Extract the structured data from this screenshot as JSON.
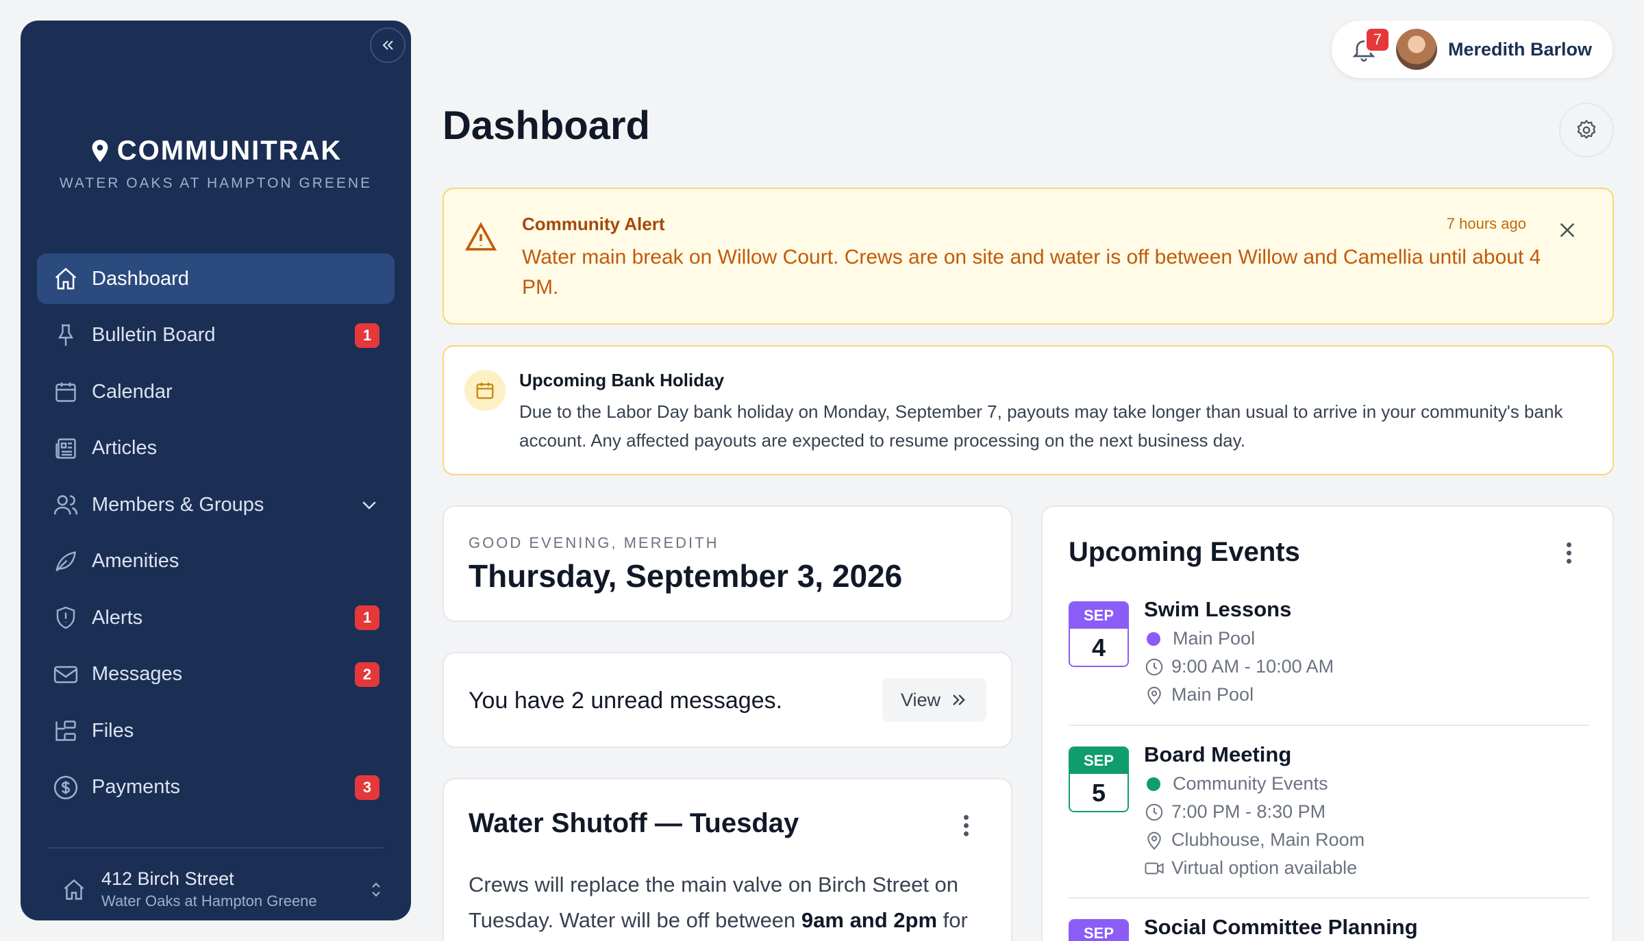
{
  "sidebar": {
    "brand": "COMMUNITRAK",
    "community": "WATER OAKS AT HAMPTON GREENE",
    "items": [
      {
        "label": "Dashboard",
        "icon": "home-icon",
        "badge": ""
      },
      {
        "label": "Bulletin Board",
        "icon": "pin-icon",
        "badge": "1"
      },
      {
        "label": "Calendar",
        "icon": "calendar-icon",
        "badge": ""
      },
      {
        "label": "Articles",
        "icon": "newspaper-icon",
        "badge": ""
      },
      {
        "label": "Members & Groups",
        "icon": "users-icon",
        "badge": ""
      },
      {
        "label": "Amenities",
        "icon": "leaf-icon",
        "badge": ""
      },
      {
        "label": "Alerts",
        "icon": "shield-alert-icon",
        "badge": "1"
      },
      {
        "label": "Messages",
        "icon": "mail-icon",
        "badge": "2"
      },
      {
        "label": "Files",
        "icon": "folder-tree-icon",
        "badge": ""
      },
      {
        "label": "Payments",
        "icon": "dollar-circle-icon",
        "badge": "3"
      }
    ],
    "address": {
      "line1": "412 Birch Street",
      "line2": "Water Oaks at Hampton Greene"
    }
  },
  "header": {
    "notification_count": "7",
    "user_name": "Meredith Barlow",
    "page_title": "Dashboard"
  },
  "alert": {
    "title": "Community Alert",
    "time": "7 hours ago",
    "body": "Water main break on Willow Court. Crews are on site and water is off between Willow and Camellia until about 4 PM."
  },
  "notice": {
    "title": "Upcoming Bank Holiday",
    "body": "Due to the Labor Day bank holiday on Monday, September 7, payouts may take longer than usual to arrive in your community's bank account. Any affected payouts are expected to resume processing on the next business day."
  },
  "greeting": {
    "label": "GOOD EVENING, MEREDITH",
    "date": "Thursday, September 3, 2026"
  },
  "messages": {
    "text": "You have 2 unread messages.",
    "view_label": "View"
  },
  "post": {
    "title": "Water Shutoff — Tuesday",
    "body_before": "Crews will replace the main valve on Birch Street on Tuesday. Water will be off between ",
    "body_bold": "9am and 2pm",
    "body_after": " for"
  },
  "events": {
    "title": "Upcoming Events",
    "items": [
      {
        "month": "SEP",
        "day": "4",
        "title": "Swim Lessons",
        "category": "Main Pool",
        "category_color": "#8b5cf6",
        "time": "9:00 AM - 10:00 AM",
        "location": "Main Pool",
        "virtual": ""
      },
      {
        "month": "SEP",
        "day": "5",
        "title": "Board Meeting",
        "category": "Community Events",
        "category_color": "#0f9d6b",
        "time": "7:00 PM - 8:30 PM",
        "location": "Clubhouse, Main Room",
        "virtual": "Virtual option available"
      },
      {
        "month": "SEP",
        "day": "",
        "title": "Social Committee Planning",
        "category": "",
        "category_color": "#8b5cf6",
        "time": "",
        "location": "",
        "virtual": ""
      }
    ]
  },
  "colors": {
    "sidebar_bg": "#1b2f55",
    "badge_red": "#e5383b",
    "alert_orange": "#c25a0a",
    "purple": "#8b5cf6",
    "green": "#0f9d6b"
  }
}
